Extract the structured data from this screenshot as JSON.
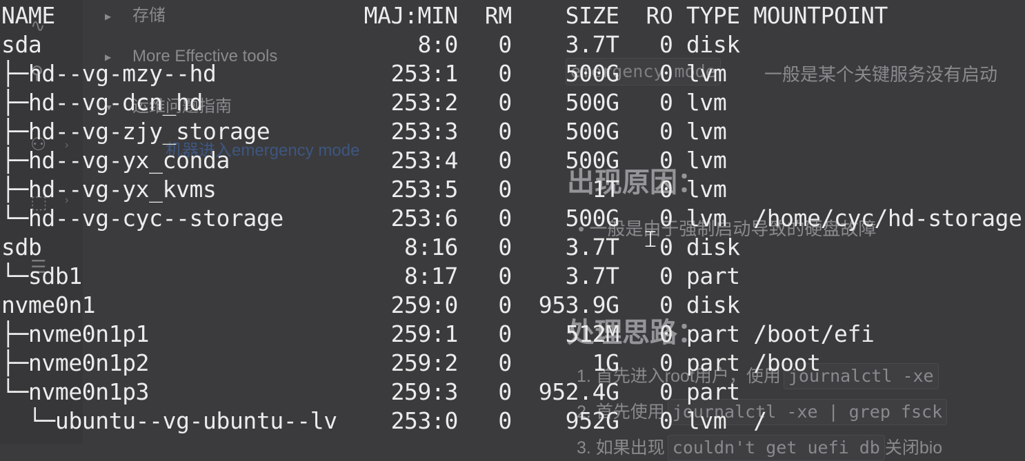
{
  "sidebar": {
    "tree_items": [
      {
        "label": "存储"
      },
      {
        "label": "More Effective tools"
      },
      {
        "label": "运维问题指南"
      }
    ],
    "link": "机器进入emergency mode",
    "icons": [
      "activity-icon",
      "search-icon",
      "users-icon",
      "dashed-box-icon",
      "text-icon"
    ]
  },
  "doc": {
    "code_inline": "emergency mode",
    "line1_text": "一般是某个关键服务没有启动",
    "heading_cause": "出现原因：",
    "cause_bullet": "• 一般是由于强制启动导致的硬盘故障",
    "heading_solution": "处理思路：",
    "steps": [
      {
        "prefix": "1. 首先进入root用户，使用",
        "code": "journalctl -xe"
      },
      {
        "prefix": "2. 首先使用",
        "code": "journalctl -xe | grep fsck"
      },
      {
        "prefix": "3. 如果出现",
        "code": "couldn't get uefi db",
        "suffix": "关闭bio"
      }
    ]
  },
  "terminal": {
    "header": {
      "name": "NAME",
      "majmin": "MAJ:MIN",
      "rm": "RM",
      "size": "SIZE",
      "ro": "RO",
      "type": "TYPE",
      "mountpoint": "MOUNTPOINT"
    },
    "rows": [
      {
        "name": "sda",
        "majmin": "8:0",
        "rm": "0",
        "size": "3.7T",
        "ro": "0",
        "type": "disk",
        "mountpoint": ""
      },
      {
        "name": "├─hd--vg-mzy--hd",
        "majmin": "253:1",
        "rm": "0",
        "size": "500G",
        "ro": "0",
        "type": "lvm",
        "mountpoint": ""
      },
      {
        "name": "├─hd--vg-dcn_hd",
        "majmin": "253:2",
        "rm": "0",
        "size": "500G",
        "ro": "0",
        "type": "lvm",
        "mountpoint": ""
      },
      {
        "name": "├─hd--vg-zjy_storage",
        "majmin": "253:3",
        "rm": "0",
        "size": "500G",
        "ro": "0",
        "type": "lvm",
        "mountpoint": ""
      },
      {
        "name": "├─hd--vg-yx_conda",
        "majmin": "253:4",
        "rm": "0",
        "size": "500G",
        "ro": "0",
        "type": "lvm",
        "mountpoint": ""
      },
      {
        "name": "├─hd--vg-yx_kvms",
        "majmin": "253:5",
        "rm": "0",
        "size": "1T",
        "ro": "0",
        "type": "lvm",
        "mountpoint": ""
      },
      {
        "name": "└─hd--vg-cyc--storage",
        "majmin": "253:6",
        "rm": "0",
        "size": "500G",
        "ro": "0",
        "type": "lvm",
        "mountpoint": "/home/cyc/hd-storage"
      },
      {
        "name": "sdb",
        "majmin": "8:16",
        "rm": "0",
        "size": "3.7T",
        "ro": "0",
        "type": "disk",
        "mountpoint": ""
      },
      {
        "name": "└─sdb1",
        "majmin": "8:17",
        "rm": "0",
        "size": "3.7T",
        "ro": "0",
        "type": "part",
        "mountpoint": ""
      },
      {
        "name": "nvme0n1",
        "majmin": "259:0",
        "rm": "0",
        "size": "953.9G",
        "ro": "0",
        "type": "disk",
        "mountpoint": ""
      },
      {
        "name": "├─nvme0n1p1",
        "majmin": "259:1",
        "rm": "0",
        "size": "512M",
        "ro": "0",
        "type": "part",
        "mountpoint": "/boot/efi"
      },
      {
        "name": "├─nvme0n1p2",
        "majmin": "259:2",
        "rm": "0",
        "size": "1G",
        "ro": "0",
        "type": "part",
        "mountpoint": "/boot"
      },
      {
        "name": "└─nvme0n1p3",
        "majmin": "259:3",
        "rm": "0",
        "size": "952.4G",
        "ro": "0",
        "type": "part",
        "mountpoint": ""
      },
      {
        "name": "  └─ubuntu--vg-ubuntu--lv",
        "majmin": "253:0",
        "rm": "0",
        "size": "952G",
        "ro": "0",
        "type": "lvm",
        "mountpoint": "/"
      }
    ]
  }
}
